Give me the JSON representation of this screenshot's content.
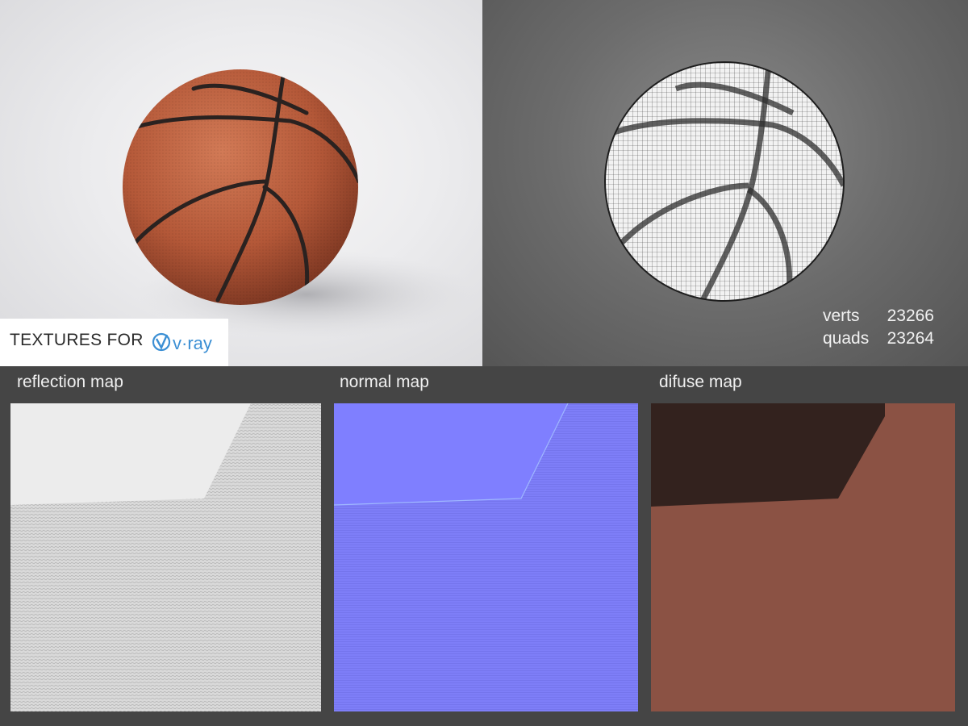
{
  "render": {
    "badge_text": "TEXTURES FOR",
    "logo": "v·ray",
    "logo_icon": "vray-logo-icon"
  },
  "wireframe": {
    "stats": [
      {
        "label": "verts",
        "value": "23266"
      },
      {
        "label": "quads",
        "value": "23264"
      }
    ]
  },
  "maps": [
    {
      "title": "reflection map",
      "color": "#d7d7d7"
    },
    {
      "title": "normal map",
      "color": "#7f7fff"
    },
    {
      "title": "difuse map",
      "color": "#8b5244"
    }
  ],
  "colors": {
    "background": "#454545",
    "ball": "#b85a3b",
    "seam": "#2a2220",
    "vray_blue": "#3b8fd4"
  }
}
